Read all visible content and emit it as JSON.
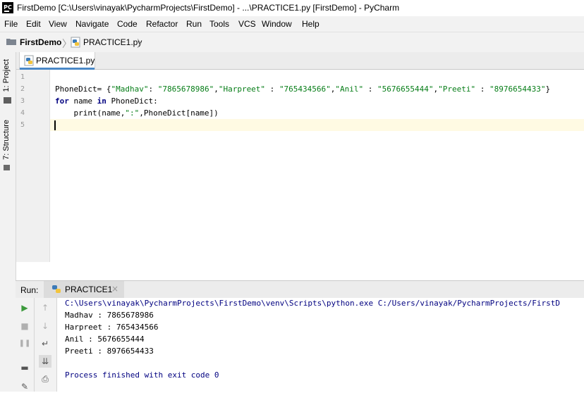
{
  "window": {
    "title": "FirstDemo [C:\\Users\\vinayak\\PycharmProjects\\FirstDemo] - ...\\PRACTICE1.py [FirstDemo] - PyCharm",
    "logo_text": "PC"
  },
  "menu": [
    "File",
    "Edit",
    "View",
    "Navigate",
    "Code",
    "Refactor",
    "Run",
    "Tools",
    "VCS",
    "Window",
    "Help"
  ],
  "navbar": {
    "project": "FirstDemo",
    "file": "PRACTICE1.py",
    "sep": "〉"
  },
  "left_strip": {
    "project_tab": "1: Project",
    "structure_tab": "7: Structure"
  },
  "editor": {
    "tab_label": "PRACTICE1.py",
    "line_numbers": [
      "1",
      "2",
      "3",
      "4",
      "5"
    ],
    "code": {
      "line2": {
        "a": "PhoneDict= {",
        "k1": "\"Madhav\"",
        "sep1": ": ",
        "v1": "\"7865678986\"",
        "c1": ",",
        "k2": "\"Harpreet\"",
        "sep2": " : ",
        "v2": "\"765434566\"",
        "c2": ",",
        "k3": "\"Anil\"",
        "sep3": " : ",
        "v3": "\"5676655444\"",
        "c3": ",",
        "k4": "\"Preeti\"",
        "sep4": " : ",
        "v4": "\"8976654433\"",
        "end": "}"
      },
      "line3": {
        "kw_for": "for",
        "mid": " name ",
        "kw_in": "in",
        "rest": " PhoneDict:"
      },
      "line4": {
        "a": "    print(name,",
        "s": "\":\"",
        "b": ",PhoneDict[name])"
      }
    }
  },
  "run": {
    "label": "Run:",
    "tab_label": "PRACTICE1",
    "close": "×",
    "console": {
      "command": "C:\\Users\\vinayak\\PycharmProjects\\FirstDemo\\venv\\Scripts\\python.exe C:/Users/vinayak/PycharmProjects/FirstD",
      "outputs": [
        "Madhav : 7865678986",
        "Harpreet : 765434566",
        "Anil : 5676655444",
        "Preeti : 8976654433"
      ],
      "finish": "Process finished with exit code 0"
    },
    "tools": {
      "play": "▶",
      "up": "↑",
      "stop": "■",
      "down": "↓",
      "pause": "❚❚",
      "wrap": "↵",
      "layout": "▬",
      "scroll_end": "⇊",
      "print": "⎙",
      "pin": "✎"
    }
  },
  "colors": {
    "string": "#067d17",
    "keyword": "#000080",
    "current_line": "#fffae3",
    "accent": "#4a88c7"
  }
}
